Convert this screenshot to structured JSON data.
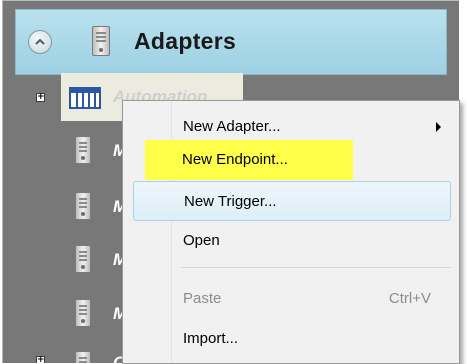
{
  "header": {
    "title": "Adapters"
  },
  "tree": {
    "selected_label": "Automation",
    "children": [
      {
        "label": "M"
      },
      {
        "label": "M"
      },
      {
        "label": "M"
      },
      {
        "label": "M"
      },
      {
        "label": "O"
      }
    ]
  },
  "context_menu": {
    "items": [
      {
        "label": "New Adapter...",
        "has_submenu": true
      },
      {
        "label": "New Endpoint...",
        "highlighted": true,
        "highlight_color": "#ffff4a"
      },
      {
        "label": "New Trigger...",
        "hovered": true
      },
      {
        "label": "Open"
      },
      {
        "label": "Paste",
        "shortcut": "Ctrl+V",
        "disabled": true
      },
      {
        "label": "Import..."
      }
    ]
  },
  "colors": {
    "header_bg": "#b9e1ee",
    "tree_bg": "#787878",
    "menu_bg": "#f1f1f1",
    "highlight": "#ffff4a"
  }
}
